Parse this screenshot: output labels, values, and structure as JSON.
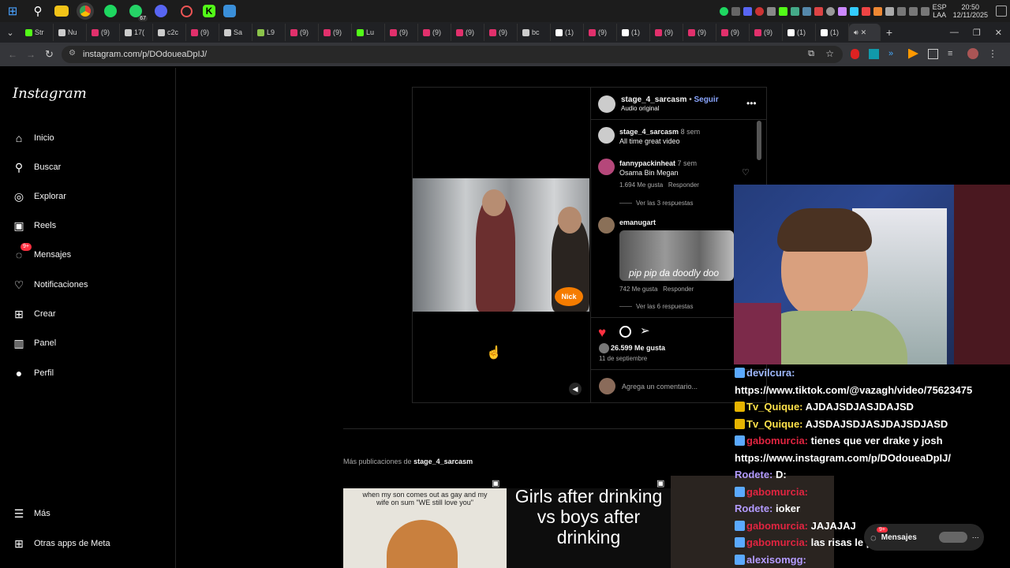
{
  "taskbar": {
    "icons": [
      "windows-icon",
      "search-icon",
      "files-icon",
      "chrome-icon",
      "spotify-icon",
      "whatsapp-icon",
      "discord-icon",
      "clock-app-icon",
      "kick-icon",
      "photos-icon"
    ],
    "whatsapp_badge": "67",
    "language": "ESP",
    "layout": "LAA",
    "time": "20:50",
    "date": "12/11/2025"
  },
  "tabs": [
    {
      "label": "Str",
      "color": "#53fc18"
    },
    {
      "label": "Nu",
      "color": "#cccccc"
    },
    {
      "label": "(9)",
      "color": "#e1306c"
    },
    {
      "label": "17(",
      "color": "#cccccc"
    },
    {
      "label": "c2c",
      "color": "#cccccc"
    },
    {
      "label": "(9)",
      "color": "#e1306c"
    },
    {
      "label": "Sa",
      "color": "#cccccc"
    },
    {
      "label": "L9",
      "color": "#8bc34a"
    },
    {
      "label": "(9)",
      "color": "#e1306c"
    },
    {
      "label": "(9)",
      "color": "#e1306c"
    },
    {
      "label": "Lu",
      "color": "#53fc18"
    },
    {
      "label": "(9)",
      "color": "#e1306c"
    },
    {
      "label": "(9)",
      "color": "#e1306c"
    },
    {
      "label": "(9)",
      "color": "#e1306c"
    },
    {
      "label": "(9)",
      "color": "#e1306c"
    },
    {
      "label": "bc",
      "color": "#cccccc"
    },
    {
      "label": "(1)",
      "color": "#ffffff"
    },
    {
      "label": "(9)",
      "color": "#e1306c"
    },
    {
      "label": "(1)",
      "color": "#ffffff"
    },
    {
      "label": "(9)",
      "color": "#e1306c"
    },
    {
      "label": "(9)",
      "color": "#e1306c"
    },
    {
      "label": "(9)",
      "color": "#e1306c"
    },
    {
      "label": "(9)",
      "color": "#e1306c"
    },
    {
      "label": "(1)",
      "color": "#ffffff"
    },
    {
      "label": "(1)",
      "color": "#ffffff"
    }
  ],
  "browser": {
    "url": "instagram.com/p/DOdoueaDpIJ/"
  },
  "sidebar": {
    "logo": "Instagram",
    "items": [
      {
        "label": "Inicio",
        "icon": "home-icon",
        "glyph": "⌂"
      },
      {
        "label": "Buscar",
        "icon": "search-icon",
        "glyph": "⚲"
      },
      {
        "label": "Explorar",
        "icon": "compass-icon",
        "glyph": "◎"
      },
      {
        "label": "Reels",
        "icon": "reels-icon",
        "glyph": "▣"
      },
      {
        "label": "Mensajes",
        "icon": "messenger-icon",
        "glyph": "◌",
        "badge": "9+"
      },
      {
        "label": "Notificaciones",
        "icon": "heart-icon",
        "glyph": "♡"
      },
      {
        "label": "Crear",
        "icon": "plus-square-icon",
        "glyph": "⊞"
      },
      {
        "label": "Panel",
        "icon": "chart-icon",
        "glyph": "▥"
      },
      {
        "label": "Perfil",
        "icon": "avatar",
        "glyph": "●"
      }
    ],
    "more": "Más",
    "meta_apps": "Otras apps de Meta"
  },
  "post": {
    "username": "stage_4_sarcasm",
    "follow": "Seguir",
    "audio": "Audio original",
    "video_overlay": "Nick",
    "comments": [
      {
        "user": "stage_4_sarcasm",
        "time": "8 sem",
        "text": "All time great video"
      },
      {
        "user": "fannypackinheat",
        "time": "7 sem",
        "text": "Osama Bin Megan",
        "likes": "1.694 Me gusta",
        "reply": "Responder",
        "replies": "Ver las 3 respuestas"
      },
      {
        "user": "emanugart",
        "gif_text": "pip pip da doodly doo",
        "likes": "742 Me gusta",
        "reply": "Responder",
        "replies": "Ver las 6 respuestas"
      }
    ],
    "likes": "26.599 Me gusta",
    "date": "11 de septiembre",
    "add_comment": "Agrega un comentario..."
  },
  "more_posts": {
    "prefix": "Más publicaciones de",
    "user": "stage_4_sarcasm",
    "thumbs": [
      {
        "text": "when my son comes out as gay and my wife on sum \"WE still love you\""
      },
      {
        "text": "Girls after drinking vs boys after drinking"
      }
    ]
  },
  "chat": [
    {
      "user": "devilcura:",
      "msg": "",
      "color": "#9fb9ff",
      "badge": "blue"
    },
    {
      "user": "",
      "msg": "https://www.tiktok.com/@vazagh/video/75623475",
      "color": "#ffffff",
      "badge": ""
    },
    {
      "user": "Tv_Quique:",
      "msg": "AJDAJSDJASJDAJSD",
      "color": "#ffe24a",
      "badge": "yellow"
    },
    {
      "user": "Tv_Quique:",
      "msg": "AJSDAJSDJASJDAJSDJASD",
      "color": "#ffe24a",
      "badge": "yellow"
    },
    {
      "user": "gabomurcia:",
      "msg": "tienes que ver drake y josh",
      "color": "#e02440",
      "badge": "blue"
    },
    {
      "user": "",
      "msg": "https://www.instagram.com/p/DOdoueaDpIJ/",
      "color": "#ffffff",
      "badge": ""
    },
    {
      "user": "Rodete:",
      "msg": "D:",
      "color": "#b39bff",
      "badge": ""
    },
    {
      "user": "gabomurcia:",
      "msg": "",
      "color": "#e02440",
      "badge": "blue"
    },
    {
      "user": "Rodete:",
      "msg": "ioker",
      "color": "#b39bff",
      "badge": ""
    },
    {
      "user": "gabomurcia:",
      "msg": "JAJAJAJ",
      "color": "#e02440",
      "badge": "blue"
    },
    {
      "user": "gabomurcia:",
      "msg": "las risas le ponian",
      "color": "#e02440",
      "badge": "blue"
    },
    {
      "user": "alexisomgg:",
      "msg": "",
      "color": "#b39bff",
      "badge": "blue"
    }
  ],
  "messages_popup": {
    "label": "Mensajes",
    "badge": "9+"
  }
}
